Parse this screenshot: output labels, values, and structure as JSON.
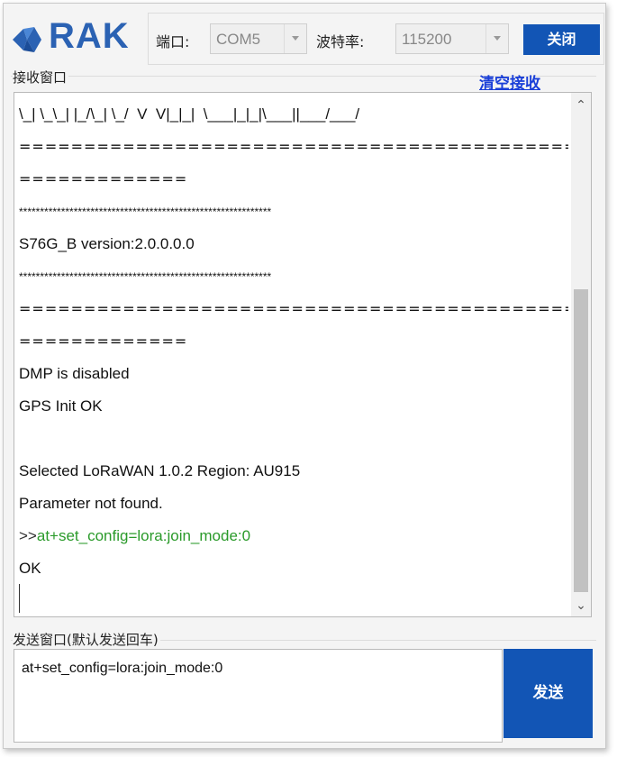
{
  "brand": {
    "logo_text": "RAK",
    "accent": "#2b62b3"
  },
  "toolbar": {
    "port_label": "端口:",
    "port_value": "COM5",
    "baud_label": "波特率:",
    "baud_value": "115200",
    "close_label": "关闭"
  },
  "receive": {
    "group_label": "接收窗口",
    "clear_label": "清空接收",
    "lines": [
      {
        "text": "\\_| \\_\\_| |_/\\_| \\_/  V  V|_|_|  \\___|_|_|\\___||___/___/"
      },
      {
        "text": "==========================================="
      },
      {
        "text": "============="
      },
      {
        "text": "************************************************************"
      },
      {
        "text": "S76G_B version:2.0.0.0.0"
      },
      {
        "text": "************************************************************"
      },
      {
        "text": "==========================================="
      },
      {
        "text": "============="
      },
      {
        "text": "DMP is disabled"
      },
      {
        "text": "GPS Init OK"
      },
      {
        "text": ""
      },
      {
        "text": "Selected LoRaWAN 1.0.2 Region: AU915"
      },
      {
        "text": "Parameter not found."
      },
      {
        "prompt": ">>",
        "text": "at+set_config=lora:join_mode:0"
      },
      {
        "text": "OK"
      }
    ]
  },
  "send": {
    "group_label": "发送窗口(默认发送回车)",
    "input_value": "at+set_config=lora:join_mode:0",
    "send_label": "发送"
  },
  "colors": {
    "button": "#1255b5",
    "command": "#2a9a2a",
    "link": "#1a3fd8"
  }
}
